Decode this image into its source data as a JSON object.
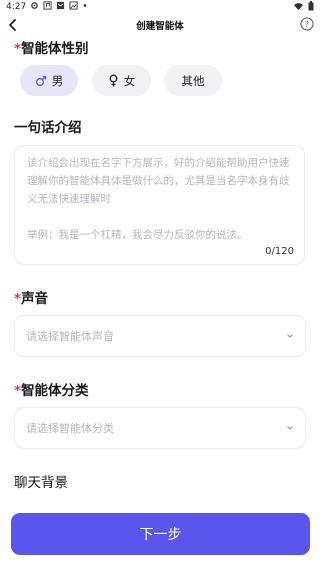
{
  "status_bar": {
    "time": "4:27"
  },
  "nav": {
    "title": "创建智能体"
  },
  "gender": {
    "label_required": "*",
    "label": "智能体性别",
    "options": [
      {
        "label": "男",
        "icon": "male-icon",
        "selected": true
      },
      {
        "label": "女",
        "icon": "female-icon",
        "selected": false
      },
      {
        "label": "其他",
        "icon": "",
        "selected": false
      }
    ]
  },
  "intro": {
    "label": "一句话介绍",
    "placeholder": "该介绍会出现在名字下方展示，好的介绍能帮助用户快速理解你的智能体具体是做什么的，尤其是当名字本身有歧义无法快速理解时",
    "example": "举例：我是一个杠精，我会尽力反驳你的说法。",
    "counter": "0/120"
  },
  "voice": {
    "label_required": "*",
    "label": "声音",
    "placeholder": "请选择智能体声音"
  },
  "category": {
    "label_required": "*",
    "label": "智能体分类",
    "placeholder": "请选择智能体分类"
  },
  "background": {
    "label": "聊天背景"
  },
  "footer": {
    "next_label": "下一步"
  },
  "colors": {
    "accent": "#5a55ec",
    "required": "#e53935"
  }
}
